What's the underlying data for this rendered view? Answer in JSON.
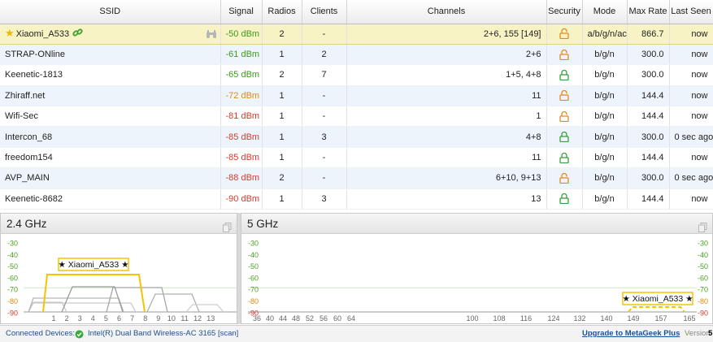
{
  "table": {
    "headers": {
      "ssid": "SSID",
      "signal": "Signal",
      "radios": "Radios",
      "clients": "Clients",
      "channels": "Channels",
      "security": "Security",
      "mode": "Mode",
      "max_rate": "Max Rate",
      "last_seen": "Last Seen"
    },
    "rows": [
      {
        "ssid": "Xiaomi_A533",
        "signal": "-50 dBm",
        "radios": "2",
        "clients": "-",
        "channels": "2+6, 155 [149]",
        "mode": "a/b/g/n/ac",
        "max_rate": "866.7",
        "last_seen": "now"
      },
      {
        "ssid": "STRAP-ONline",
        "signal": "-61 dBm",
        "radios": "1",
        "clients": "2",
        "channels": "2+6",
        "mode": "b/g/n",
        "max_rate": "300.0",
        "last_seen": "now"
      },
      {
        "ssid": "Keenetic-1813",
        "signal": "-65 dBm",
        "radios": "2",
        "clients": "7",
        "channels": "1+5, 4+8",
        "mode": "b/g/n",
        "max_rate": "300.0",
        "last_seen": "now"
      },
      {
        "ssid": "Zhiraff.net",
        "signal": "-72 dBm",
        "radios": "1",
        "clients": "-",
        "channels": "11",
        "mode": "b/g/n",
        "max_rate": "144.4",
        "last_seen": "now"
      },
      {
        "ssid": "Wifi-Sec",
        "signal": "-81 dBm",
        "radios": "1",
        "clients": "-",
        "channels": "1",
        "mode": "b/g/n",
        "max_rate": "144.4",
        "last_seen": "now"
      },
      {
        "ssid": "Intercon_68",
        "signal": "-85 dBm",
        "radios": "1",
        "clients": "3",
        "channels": "4+8",
        "mode": "b/g/n",
        "max_rate": "300.0",
        "last_seen": "0 sec ago"
      },
      {
        "ssid": "freedom154",
        "signal": "-85 dBm",
        "radios": "1",
        "clients": "-",
        "channels": "11",
        "mode": "b/g/n",
        "max_rate": "144.4",
        "last_seen": "now"
      },
      {
        "ssid": "AVP_MAIN",
        "signal": "-88 dBm",
        "radios": "2",
        "clients": "-",
        "channels": "6+10, 9+13",
        "mode": "b/g/n",
        "max_rate": "300.0",
        "last_seen": "0 sec ago"
      },
      {
        "ssid": "Keenetic-8682",
        "signal": "-90 dBm",
        "radios": "1",
        "clients": "3",
        "channels": "13",
        "mode": "b/g/n",
        "max_rate": "144.4",
        "last_seen": "now"
      }
    ]
  },
  "graph24": {
    "title": "2.4 GHz",
    "y_ticks": [
      "-30",
      "-40",
      "-50",
      "-60",
      "-70",
      "-80",
      "-90"
    ],
    "x_ticks": [
      "1",
      "2",
      "3",
      "4",
      "5",
      "6",
      "7",
      "8",
      "9",
      "10",
      "11",
      "12",
      "13"
    ],
    "label": "★ Xiaomi_A533 ★"
  },
  "graph5": {
    "title": "5 GHz",
    "y_ticks": [
      "-30",
      "-40",
      "-50",
      "-60",
      "-70",
      "-80",
      "-90"
    ],
    "x_ticks": [
      "36",
      "40",
      "44",
      "48",
      "52",
      "56",
      "60",
      "64",
      "100",
      "108",
      "116",
      "124",
      "132",
      "140",
      "149",
      "157",
      "165"
    ],
    "label": "★ Xiaomi_A533 ★"
  },
  "status": {
    "connected_label": "Connected Devices:",
    "device": "Intel(R) Dual Band Wireless-AC 3165 [scan]",
    "upgrade": "Upgrade to MetaGeek Plus",
    "version_label": "Version",
    "version_value": "5"
  },
  "colors": {
    "selected_row": "#f7f3c4",
    "alt_row": "#eef4fb",
    "signal_good": "#3c9a1f",
    "signal_mid": "#e0891a",
    "signal_bad": "#d83a2b",
    "highlight": "#f5c400",
    "lock_open": "#e58a1a",
    "lock_closed": "#3a9e3a"
  }
}
